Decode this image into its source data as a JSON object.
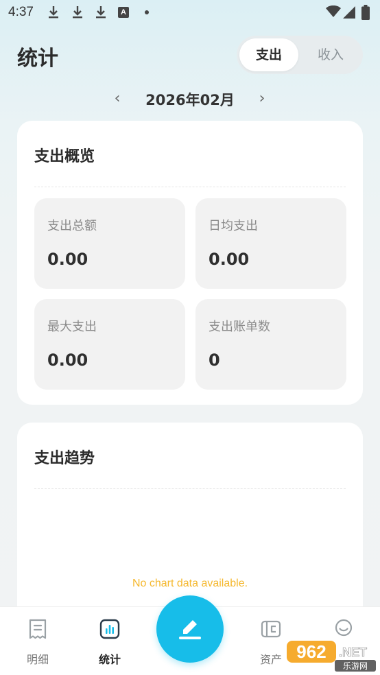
{
  "status_bar": {
    "time": "4:37",
    "a_badge": "A"
  },
  "header": {
    "title": "统计",
    "segments": {
      "expense": "支出",
      "income": "收入"
    },
    "active_segment": "expense"
  },
  "month_nav": {
    "prev": "‹",
    "label": "2026年02月",
    "next": "›"
  },
  "overview": {
    "title": "支出概览",
    "stats": [
      {
        "label": "支出总额",
        "value": "0.00"
      },
      {
        "label": "日均支出",
        "value": "0.00"
      },
      {
        "label": "最大支出",
        "value": "0.00"
      },
      {
        "label": "支出账单数",
        "value": "0"
      }
    ]
  },
  "trend": {
    "title": "支出趋势",
    "empty_message": "No chart data available."
  },
  "tabs": [
    {
      "label": "明细",
      "icon": "receipt-icon",
      "active": false
    },
    {
      "label": "统计",
      "icon": "bar-chart-icon",
      "active": true
    },
    {
      "label": "资产",
      "icon": "wallet-icon",
      "active": false
    },
    {
      "label": "",
      "icon": "user-icon",
      "active": false
    }
  ],
  "fab": {
    "icon": "pen-icon"
  },
  "watermark": {
    "text_top": "962.NET",
    "text_bottom": "乐游网"
  },
  "colors": {
    "accent": "#17bde9",
    "empty_text": "#f5b82e",
    "card_bg": "#ffffff",
    "stat_bg": "#f2f2f2"
  }
}
